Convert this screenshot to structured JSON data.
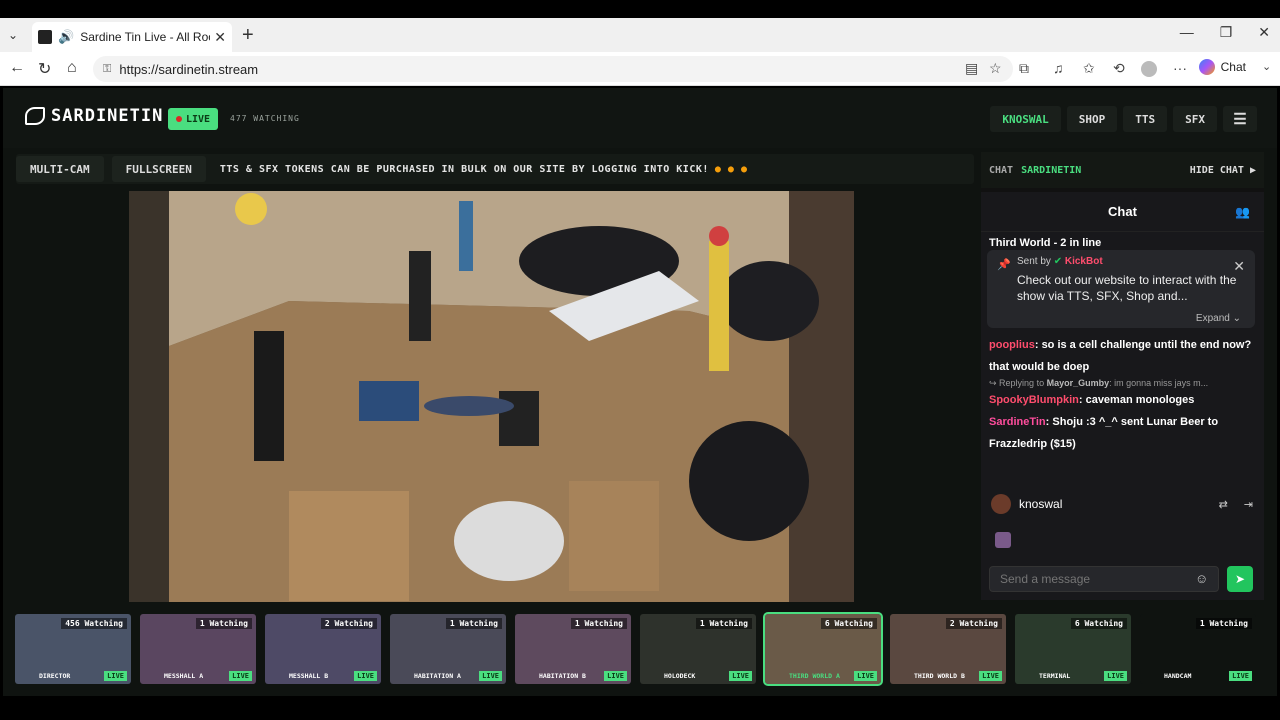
{
  "browser": {
    "tab_title": "Sardine Tin Live - All Rooms, A",
    "url": "https://sardinetin.stream",
    "chat_label": "Chat"
  },
  "site": {
    "logo_text": "SARDINETIN",
    "live_label": "LIVE",
    "watching": "477 WATCHING",
    "nav": [
      "KNOSWAL",
      "SHOP",
      "TTS",
      "SFX"
    ],
    "multicam_label": "MULTI-CAM",
    "fullscreen_label": "FULLSCREEN",
    "ticker": "TTS & SFX TOKENS CAN BE PURCHASED IN BULK ON OUR SITE BY LOGGING INTO KICK!"
  },
  "chat": {
    "header_label": "CHAT",
    "channel": "SARDINETIN",
    "hide_label": "HIDE CHAT",
    "title": "Chat",
    "top_line": "Third World - 2 in line",
    "pinned": {
      "sent_by": "Sent by",
      "sender": "KickBot",
      "body": "Check out our website to interact with the show via TTS, SFX, Shop and...",
      "expand": "Expand"
    },
    "messages": [
      {
        "user": "pooplius",
        "text": "so is a cell challenge until the end now? that would be doep"
      },
      {
        "reply_user": "Mayor_Gumby",
        "reply_text": "im gonna miss jays m...",
        "reply_prefix": "Replying to",
        "user": "SpookyBlumpkin",
        "text": "caveman monologes"
      },
      {
        "user": "SardineTin",
        "text": "Shoju :3 ^_^ sent Lunar Beer to Frazzledrip ($15)"
      }
    ],
    "username": "knoswal",
    "input_placeholder": "Send a message"
  },
  "cameras": [
    {
      "name": "DIRECTOR",
      "watching": "456 Watching",
      "live": "LIVE"
    },
    {
      "name": "MESSHALL A",
      "watching": "1 Watching",
      "live": "LIVE"
    },
    {
      "name": "MESSHALL B",
      "watching": "2 Watching",
      "live": "LIVE"
    },
    {
      "name": "HABITATION A",
      "watching": "1 Watching",
      "live": "LIVE"
    },
    {
      "name": "HABITATION B",
      "watching": "1 Watching",
      "live": "LIVE"
    },
    {
      "name": "HOLODECK",
      "watching": "1 Watching",
      "live": "LIVE"
    },
    {
      "name": "THIRD WORLD A",
      "watching": "6 Watching",
      "live": "LIVE"
    },
    {
      "name": "THIRD WORLD B",
      "watching": "2 Watching",
      "live": "LIVE"
    },
    {
      "name": "TERMINAL",
      "watching": "6 Watching",
      "live": "LIVE"
    },
    {
      "name": "HANDCAM",
      "watching": "1 Watching",
      "live": "LIVE"
    }
  ],
  "colors": {
    "accent": "#4ade80",
    "kickbot": "#ff4d6d"
  }
}
